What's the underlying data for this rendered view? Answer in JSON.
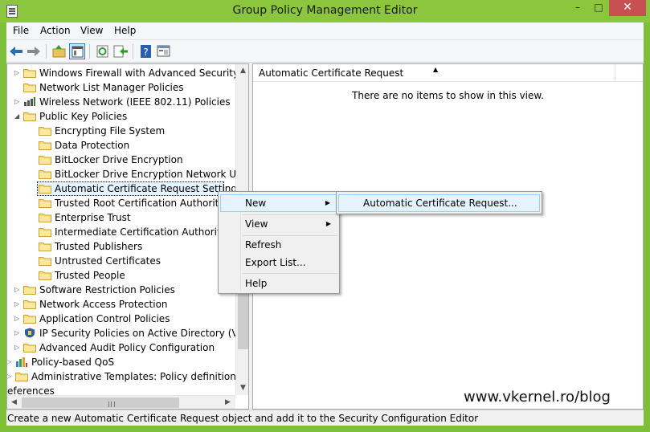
{
  "window": {
    "title": "Group Policy Management Editor",
    "minimize_glyph": "–",
    "maximize_glyph": "□",
    "close_glyph": "✕"
  },
  "menubar": [
    "File",
    "Action",
    "View",
    "Help"
  ],
  "toolbar": {
    "icons": [
      "back-arrow-icon",
      "forward-arrow-icon",
      "up-folder-icon",
      "show-hide-tree-icon",
      "refresh-icon",
      "export-list-icon",
      "help-icon",
      "properties-icon"
    ]
  },
  "tree": {
    "items": [
      {
        "label": "Windows Firewall with Advanced Security",
        "expander": "▷",
        "icon": "folder-icon"
      },
      {
        "label": "Network List Manager Policies",
        "expander": "",
        "icon": "folder-icon"
      },
      {
        "label": "Wireless Network (IEEE 802.11) Policies",
        "expander": "▷",
        "icon": "wireless-network-icon"
      },
      {
        "label": "Public Key Policies",
        "expander": "◢",
        "icon": "folder-icon"
      },
      {
        "label": "Encrypting File System",
        "expander": "",
        "icon": "folder-icon"
      },
      {
        "label": "Data Protection",
        "expander": "",
        "icon": "folder-icon"
      },
      {
        "label": "BitLocker Drive Encryption",
        "expander": "",
        "icon": "folder-icon"
      },
      {
        "label": "BitLocker Drive Encryption Network Unloc",
        "expander": "",
        "icon": "folder-icon"
      },
      {
        "label": "Automatic Certificate Request Settings",
        "expander": "",
        "icon": "folder-icon",
        "selected": true
      },
      {
        "label": "Trusted Root Certification Authorities",
        "expander": "",
        "icon": "folder-icon"
      },
      {
        "label": "Enterprise Trust",
        "expander": "",
        "icon": "folder-icon"
      },
      {
        "label": "Intermediate Certification Authorities",
        "expander": "",
        "icon": "folder-icon"
      },
      {
        "label": "Trusted Publishers",
        "expander": "",
        "icon": "folder-icon"
      },
      {
        "label": "Untrusted Certificates",
        "expander": "",
        "icon": "folder-icon"
      },
      {
        "label": "Trusted People",
        "expander": "",
        "icon": "folder-icon"
      },
      {
        "label": "Software Restriction Policies",
        "expander": "▷",
        "icon": "folder-icon"
      },
      {
        "label": "Network Access Protection",
        "expander": "▷",
        "icon": "folder-icon"
      },
      {
        "label": "Application Control Policies",
        "expander": "▷",
        "icon": "folder-icon"
      },
      {
        "label": "IP Security Policies on Active Directory (VKERN",
        "expander": "▷",
        "icon": "ip-security-icon"
      },
      {
        "label": "Advanced Audit Policy Configuration",
        "expander": "▷",
        "icon": "folder-icon"
      },
      {
        "label": "Policy-based QoS",
        "expander": "▷",
        "icon": "qos-chart-icon"
      },
      {
        "label": "Administrative Templates: Policy definitions (ADMX",
        "expander": "▷",
        "icon": "folder-icon"
      },
      {
        "label": "eferences",
        "expander": "",
        "icon": ""
      }
    ]
  },
  "scroll": {
    "up": "▲",
    "down": "▼",
    "left": "◀",
    "right": "▶"
  },
  "right_pane": {
    "column_header": "Automatic Certificate Request",
    "sort_glyph": "▲",
    "empty_message": "There are no items to show in this view."
  },
  "watermark": "www.vkernel.ro/blog",
  "status": "Create a new Automatic Certificate Request object and add it to the Security Configuration Editor",
  "context_menu": {
    "items": [
      {
        "label": "New",
        "submenu": "▶",
        "highlighted": true
      },
      {
        "label": "View",
        "submenu": "▶"
      },
      {
        "label": "Refresh"
      },
      {
        "label": "Export List..."
      },
      {
        "label": "Help"
      }
    ]
  },
  "submenu": {
    "items": [
      {
        "label": "Automatic Certificate Request...",
        "highlighted": true
      }
    ]
  },
  "colors": {
    "title_bar": "#8cc63f",
    "close_button": "#c75050",
    "selection": "#cce8ff",
    "hover_border": "#99ccff"
  }
}
